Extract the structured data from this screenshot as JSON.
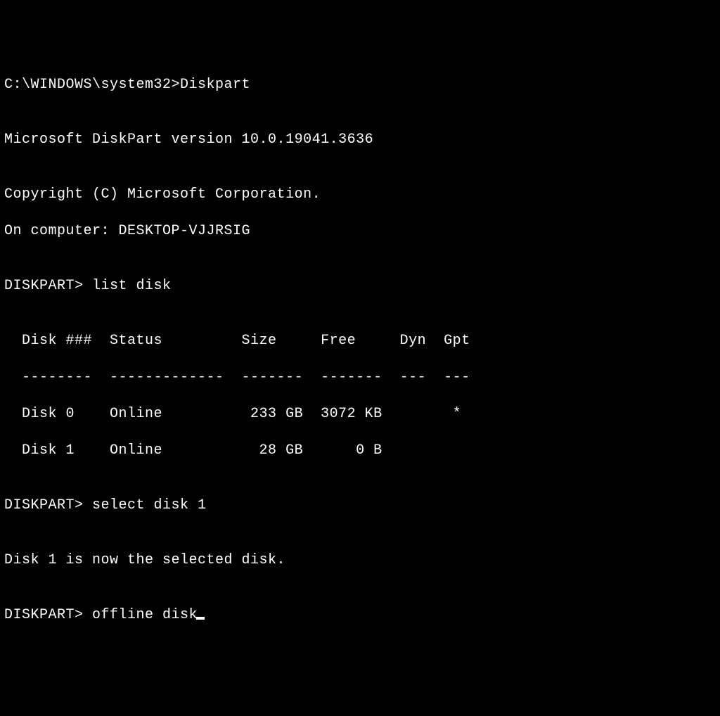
{
  "prompt1": {
    "path": "C:\\WINDOWS\\system32>",
    "command": "Diskpart"
  },
  "blank1": "",
  "version_line": "Microsoft DiskPart version 10.0.19041.3636",
  "blank2": "",
  "copyright_line": "Copyright (C) Microsoft Corporation.",
  "computer_line": "On computer: DESKTOP-VJJRSIG",
  "blank3": "",
  "prompt2": {
    "prefix": "DISKPART> ",
    "command": "list disk"
  },
  "blank4": "",
  "table_header": "  Disk ###  Status         Size     Free     Dyn  Gpt",
  "table_divider": "  --------  -------------  -------  -------  ---  ---",
  "table_row_0": "  Disk 0    Online          233 GB  3072 KB        *",
  "table_row_1": "  Disk 1    Online           28 GB      0 B",
  "blank5": "",
  "prompt3": {
    "prefix": "DISKPART> ",
    "command": "select disk 1"
  },
  "blank6": "",
  "selected_line": "Disk 1 is now the selected disk.",
  "blank7": "",
  "prompt4": {
    "prefix": "DISKPART> ",
    "command": "offline disk"
  }
}
